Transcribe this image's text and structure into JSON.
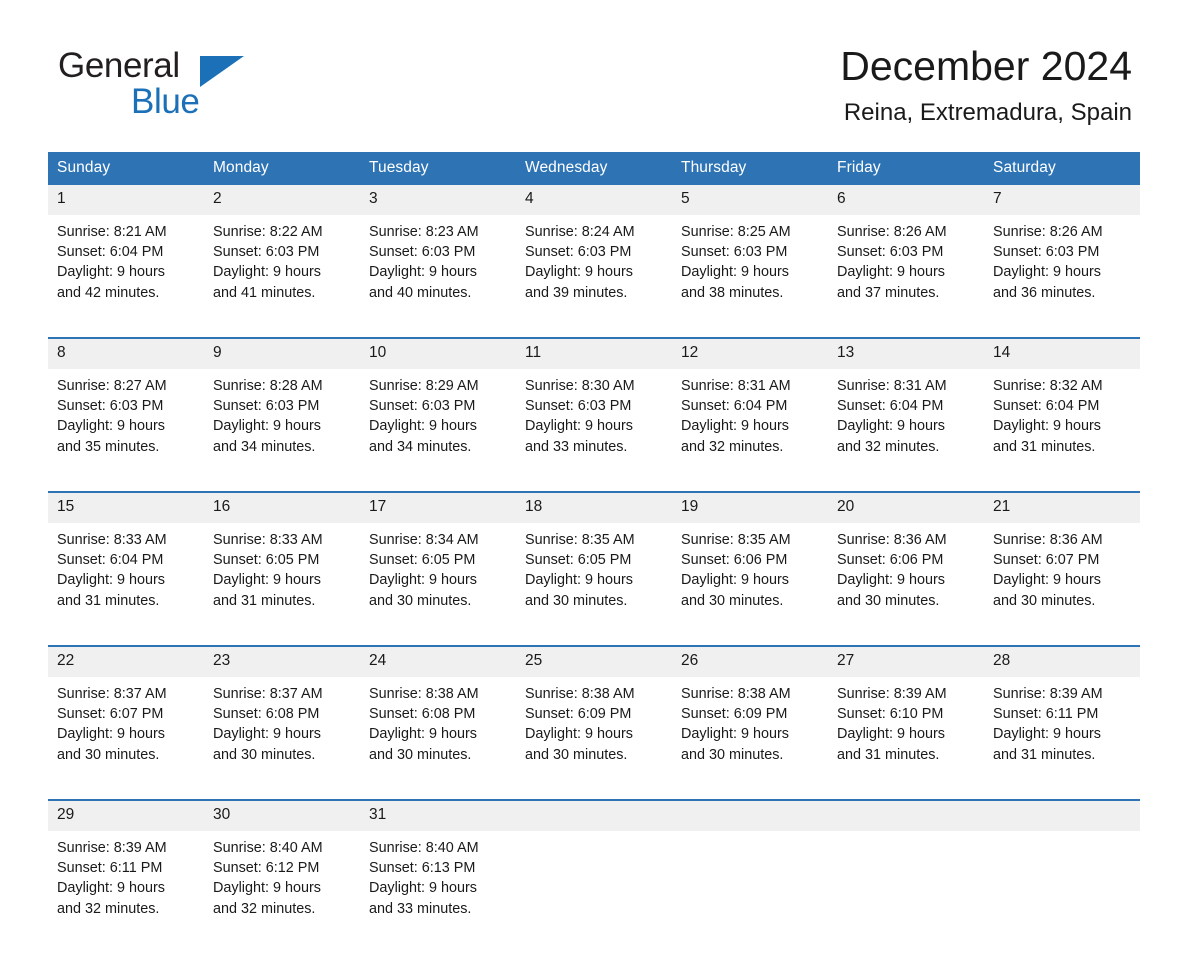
{
  "brand": {
    "name_part1": "General",
    "name_part2": "Blue",
    "triangle_color": "#1b70b8"
  },
  "header": {
    "month_title": "December 2024",
    "location": "Reina, Extremadura, Spain"
  },
  "theme": {
    "header_blue": "#2e74b5",
    "date_band_gray": "#f0f0f0",
    "text_color": "#1a1a1a"
  },
  "calendar": {
    "day_headers": [
      "Sunday",
      "Monday",
      "Tuesday",
      "Wednesday",
      "Thursday",
      "Friday",
      "Saturday"
    ],
    "weeks": [
      [
        {
          "date": "1",
          "sunrise": "Sunrise: 8:21 AM",
          "sunset": "Sunset: 6:04 PM",
          "daylight_line1": "Daylight: 9 hours",
          "daylight_line2": "and 42 minutes."
        },
        {
          "date": "2",
          "sunrise": "Sunrise: 8:22 AM",
          "sunset": "Sunset: 6:03 PM",
          "daylight_line1": "Daylight: 9 hours",
          "daylight_line2": "and 41 minutes."
        },
        {
          "date": "3",
          "sunrise": "Sunrise: 8:23 AM",
          "sunset": "Sunset: 6:03 PM",
          "daylight_line1": "Daylight: 9 hours",
          "daylight_line2": "and 40 minutes."
        },
        {
          "date": "4",
          "sunrise": "Sunrise: 8:24 AM",
          "sunset": "Sunset: 6:03 PM",
          "daylight_line1": "Daylight: 9 hours",
          "daylight_line2": "and 39 minutes."
        },
        {
          "date": "5",
          "sunrise": "Sunrise: 8:25 AM",
          "sunset": "Sunset: 6:03 PM",
          "daylight_line1": "Daylight: 9 hours",
          "daylight_line2": "and 38 minutes."
        },
        {
          "date": "6",
          "sunrise": "Sunrise: 8:26 AM",
          "sunset": "Sunset: 6:03 PM",
          "daylight_line1": "Daylight: 9 hours",
          "daylight_line2": "and 37 minutes."
        },
        {
          "date": "7",
          "sunrise": "Sunrise: 8:26 AM",
          "sunset": "Sunset: 6:03 PM",
          "daylight_line1": "Daylight: 9 hours",
          "daylight_line2": "and 36 minutes."
        }
      ],
      [
        {
          "date": "8",
          "sunrise": "Sunrise: 8:27 AM",
          "sunset": "Sunset: 6:03 PM",
          "daylight_line1": "Daylight: 9 hours",
          "daylight_line2": "and 35 minutes."
        },
        {
          "date": "9",
          "sunrise": "Sunrise: 8:28 AM",
          "sunset": "Sunset: 6:03 PM",
          "daylight_line1": "Daylight: 9 hours",
          "daylight_line2": "and 34 minutes."
        },
        {
          "date": "10",
          "sunrise": "Sunrise: 8:29 AM",
          "sunset": "Sunset: 6:03 PM",
          "daylight_line1": "Daylight: 9 hours",
          "daylight_line2": "and 34 minutes."
        },
        {
          "date": "11",
          "sunrise": "Sunrise: 8:30 AM",
          "sunset": "Sunset: 6:03 PM",
          "daylight_line1": "Daylight: 9 hours",
          "daylight_line2": "and 33 minutes."
        },
        {
          "date": "12",
          "sunrise": "Sunrise: 8:31 AM",
          "sunset": "Sunset: 6:04 PM",
          "daylight_line1": "Daylight: 9 hours",
          "daylight_line2": "and 32 minutes."
        },
        {
          "date": "13",
          "sunrise": "Sunrise: 8:31 AM",
          "sunset": "Sunset: 6:04 PM",
          "daylight_line1": "Daylight: 9 hours",
          "daylight_line2": "and 32 minutes."
        },
        {
          "date": "14",
          "sunrise": "Sunrise: 8:32 AM",
          "sunset": "Sunset: 6:04 PM",
          "daylight_line1": "Daylight: 9 hours",
          "daylight_line2": "and 31 minutes."
        }
      ],
      [
        {
          "date": "15",
          "sunrise": "Sunrise: 8:33 AM",
          "sunset": "Sunset: 6:04 PM",
          "daylight_line1": "Daylight: 9 hours",
          "daylight_line2": "and 31 minutes."
        },
        {
          "date": "16",
          "sunrise": "Sunrise: 8:33 AM",
          "sunset": "Sunset: 6:05 PM",
          "daylight_line1": "Daylight: 9 hours",
          "daylight_line2": "and 31 minutes."
        },
        {
          "date": "17",
          "sunrise": "Sunrise: 8:34 AM",
          "sunset": "Sunset: 6:05 PM",
          "daylight_line1": "Daylight: 9 hours",
          "daylight_line2": "and 30 minutes."
        },
        {
          "date": "18",
          "sunrise": "Sunrise: 8:35 AM",
          "sunset": "Sunset: 6:05 PM",
          "daylight_line1": "Daylight: 9 hours",
          "daylight_line2": "and 30 minutes."
        },
        {
          "date": "19",
          "sunrise": "Sunrise: 8:35 AM",
          "sunset": "Sunset: 6:06 PM",
          "daylight_line1": "Daylight: 9 hours",
          "daylight_line2": "and 30 minutes."
        },
        {
          "date": "20",
          "sunrise": "Sunrise: 8:36 AM",
          "sunset": "Sunset: 6:06 PM",
          "daylight_line1": "Daylight: 9 hours",
          "daylight_line2": "and 30 minutes."
        },
        {
          "date": "21",
          "sunrise": "Sunrise: 8:36 AM",
          "sunset": "Sunset: 6:07 PM",
          "daylight_line1": "Daylight: 9 hours",
          "daylight_line2": "and 30 minutes."
        }
      ],
      [
        {
          "date": "22",
          "sunrise": "Sunrise: 8:37 AM",
          "sunset": "Sunset: 6:07 PM",
          "daylight_line1": "Daylight: 9 hours",
          "daylight_line2": "and 30 minutes."
        },
        {
          "date": "23",
          "sunrise": "Sunrise: 8:37 AM",
          "sunset": "Sunset: 6:08 PM",
          "daylight_line1": "Daylight: 9 hours",
          "daylight_line2": "and 30 minutes."
        },
        {
          "date": "24",
          "sunrise": "Sunrise: 8:38 AM",
          "sunset": "Sunset: 6:08 PM",
          "daylight_line1": "Daylight: 9 hours",
          "daylight_line2": "and 30 minutes."
        },
        {
          "date": "25",
          "sunrise": "Sunrise: 8:38 AM",
          "sunset": "Sunset: 6:09 PM",
          "daylight_line1": "Daylight: 9 hours",
          "daylight_line2": "and 30 minutes."
        },
        {
          "date": "26",
          "sunrise": "Sunrise: 8:38 AM",
          "sunset": "Sunset: 6:09 PM",
          "daylight_line1": "Daylight: 9 hours",
          "daylight_line2": "and 30 minutes."
        },
        {
          "date": "27",
          "sunrise": "Sunrise: 8:39 AM",
          "sunset": "Sunset: 6:10 PM",
          "daylight_line1": "Daylight: 9 hours",
          "daylight_line2": "and 31 minutes."
        },
        {
          "date": "28",
          "sunrise": "Sunrise: 8:39 AM",
          "sunset": "Sunset: 6:11 PM",
          "daylight_line1": "Daylight: 9 hours",
          "daylight_line2": "and 31 minutes."
        }
      ],
      [
        {
          "date": "29",
          "sunrise": "Sunrise: 8:39 AM",
          "sunset": "Sunset: 6:11 PM",
          "daylight_line1": "Daylight: 9 hours",
          "daylight_line2": "and 32 minutes."
        },
        {
          "date": "30",
          "sunrise": "Sunrise: 8:40 AM",
          "sunset": "Sunset: 6:12 PM",
          "daylight_line1": "Daylight: 9 hours",
          "daylight_line2": "and 32 minutes."
        },
        {
          "date": "31",
          "sunrise": "Sunrise: 8:40 AM",
          "sunset": "Sunset: 6:13 PM",
          "daylight_line1": "Daylight: 9 hours",
          "daylight_line2": "and 33 minutes."
        },
        {
          "date": "",
          "sunrise": "",
          "sunset": "",
          "daylight_line1": "",
          "daylight_line2": ""
        },
        {
          "date": "",
          "sunrise": "",
          "sunset": "",
          "daylight_line1": "",
          "daylight_line2": ""
        },
        {
          "date": "",
          "sunrise": "",
          "sunset": "",
          "daylight_line1": "",
          "daylight_line2": ""
        },
        {
          "date": "",
          "sunrise": "",
          "sunset": "",
          "daylight_line1": "",
          "daylight_line2": ""
        }
      ]
    ]
  }
}
